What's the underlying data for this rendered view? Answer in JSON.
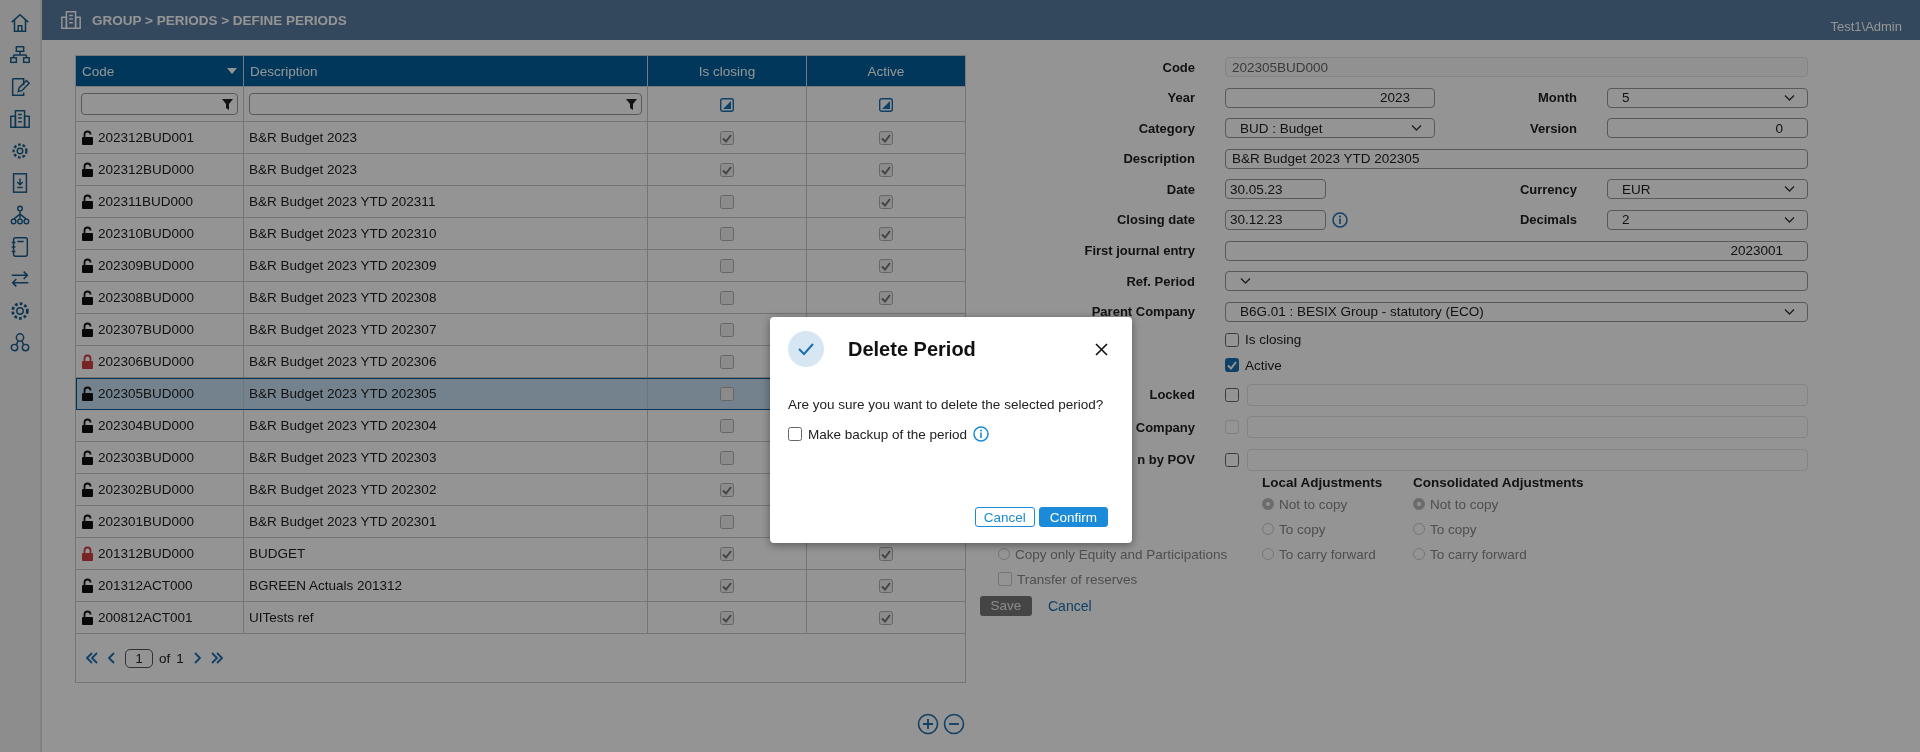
{
  "header": {
    "breadcrumb": "GROUP > PERIODS > DEFINE PERIODS",
    "user": "Test1\\Admin"
  },
  "table": {
    "columns": [
      {
        "label": "Code",
        "sorted": true
      },
      {
        "label": "Description",
        "sorted": false
      },
      {
        "label": "Is closing",
        "sorted": false
      },
      {
        "label": "Active",
        "sorted": false
      }
    ],
    "filters": [
      {
        "kind": "text"
      },
      {
        "kind": "text"
      },
      {
        "kind": "checkbox",
        "indeterminate": true
      },
      {
        "kind": "checkbox",
        "indeterminate": true
      }
    ],
    "rows": [
      {
        "code": "202312BUD001",
        "description": "B&R Budget 2023",
        "locked": false,
        "is_closing": true,
        "active": true,
        "selected": false
      },
      {
        "code": "202312BUD000",
        "description": "B&R Budget 2023",
        "locked": false,
        "is_closing": true,
        "active": true,
        "selected": false
      },
      {
        "code": "202311BUD000",
        "description": "B&R Budget 2023 YTD 202311",
        "locked": false,
        "is_closing": false,
        "active": true,
        "selected": false
      },
      {
        "code": "202310BUD000",
        "description": "B&R Budget 2023 YTD 202310",
        "locked": false,
        "is_closing": false,
        "active": true,
        "selected": false
      },
      {
        "code": "202309BUD000",
        "description": "B&R Budget 2023 YTD 202309",
        "locked": false,
        "is_closing": false,
        "active": true,
        "selected": false
      },
      {
        "code": "202308BUD000",
        "description": "B&R Budget 2023 YTD 202308",
        "locked": false,
        "is_closing": false,
        "active": true,
        "selected": false
      },
      {
        "code": "202307BUD000",
        "description": "B&R Budget 2023 YTD 202307",
        "locked": false,
        "is_closing": false,
        "selected": false
      },
      {
        "code": "202306BUD000",
        "description": "B&R Budget 2023 YTD 202306",
        "locked": true,
        "is_closing": false,
        "selected": false
      },
      {
        "code": "202305BUD000",
        "description": "B&R Budget 2023 YTD 202305",
        "locked": false,
        "is_closing": false,
        "selected": true
      },
      {
        "code": "202304BUD000",
        "description": "B&R Budget 2023 YTD 202304",
        "locked": false,
        "is_closing": false,
        "selected": false
      },
      {
        "code": "202303BUD000",
        "description": "B&R Budget 2023 YTD 202303",
        "locked": false,
        "is_closing": false,
        "selected": false
      },
      {
        "code": "202302BUD000",
        "description": "B&R Budget 2023 YTD 202302",
        "locked": false,
        "is_closing": true,
        "selected": false
      },
      {
        "code": "202301BUD000",
        "description": "B&R Budget 2023 YTD 202301",
        "locked": false,
        "is_closing": false,
        "selected": false
      },
      {
        "code": "201312BUD000",
        "description": "BUDGET",
        "locked": true,
        "is_closing": true,
        "active": true,
        "selected": false
      },
      {
        "code": "201312ACT000",
        "description": "BGREEN Actuals 201312",
        "locked": false,
        "is_closing": true,
        "active": true,
        "selected": false
      },
      {
        "code": "200812ACT001",
        "description": "UITests ref",
        "locked": false,
        "is_closing": true,
        "active": true,
        "selected": false
      }
    ],
    "pager": {
      "page": "1",
      "of": "of",
      "total": "1"
    }
  },
  "form": {
    "fields": [
      {
        "label": "Code",
        "kind": "text",
        "value": "202305BUD000",
        "disabled": true,
        "wide": true
      },
      {
        "label": "Year",
        "kind": "number",
        "value": "2023"
      },
      {
        "label": "Month",
        "kind": "select",
        "value": "5"
      },
      {
        "label": "Category",
        "kind": "select",
        "value": "BUD : Budget"
      },
      {
        "label": "Version",
        "kind": "number",
        "value": "0"
      },
      {
        "label": "Description",
        "kind": "text",
        "value": "B&R Budget 2023 YTD 202305",
        "wide": true
      },
      {
        "label": "Date",
        "kind": "date",
        "value": "30.05.23"
      },
      {
        "label": "Currency",
        "kind": "select",
        "value": "EUR"
      },
      {
        "label": "Closing date",
        "kind": "date",
        "value": "30.12.23",
        "info": true
      },
      {
        "label": "Decimals",
        "kind": "select",
        "value": "2"
      },
      {
        "label": "First journal entry",
        "kind": "number",
        "value": "2023001",
        "wide": true
      },
      {
        "label": "Ref. Period",
        "kind": "select",
        "wide": true
      },
      {
        "label": "Parent Company",
        "kind": "select",
        "value": "B6G.01 : BESIX Group - statutory (ECO)",
        "wide": true
      }
    ],
    "checks": [
      {
        "label": "Is closing",
        "checked": false
      },
      {
        "label": "Active",
        "checked": true
      }
    ],
    "flags": [
      {
        "label": "Locked",
        "checked": false,
        "disabled": false
      },
      {
        "label": "Company",
        "checked": false,
        "disabled": true
      },
      {
        "label": "n by POV",
        "checked": false,
        "disabled": false
      }
    ],
    "adjustments": {
      "columns": [
        {
          "title": "Local Adjustments",
          "options": [
            {
              "label": "Not to copy",
              "selected": true
            },
            {
              "label": "To copy",
              "selected": false
            },
            {
              "label": "To carry forward",
              "selected": false
            }
          ]
        },
        {
          "title": "Consolidated Adjustments",
          "options": [
            {
              "label": "Not to copy",
              "selected": true
            },
            {
              "label": "To copy",
              "selected": false
            },
            {
              "label": "To carry forward",
              "selected": false
            }
          ]
        }
      ],
      "left_options": [
        {
          "kind": "radio",
          "label": "Copy only Equity and Participations",
          "checked": false
        },
        {
          "kind": "checkbox",
          "label": "Transfer of reserves",
          "checked": false
        }
      ]
    },
    "save": {
      "label": "Save",
      "disabled": true
    },
    "cancel": {
      "label": "Cancel"
    }
  },
  "dialog": {
    "title": "Delete Period",
    "message": "Are you sure you want to delete the selected period?",
    "backup": {
      "label": "Make backup of the period",
      "checked": false
    },
    "buttons": [
      {
        "label": "Cancel",
        "kind": "secondary"
      },
      {
        "label": "Confirm",
        "kind": "primary"
      }
    ]
  }
}
